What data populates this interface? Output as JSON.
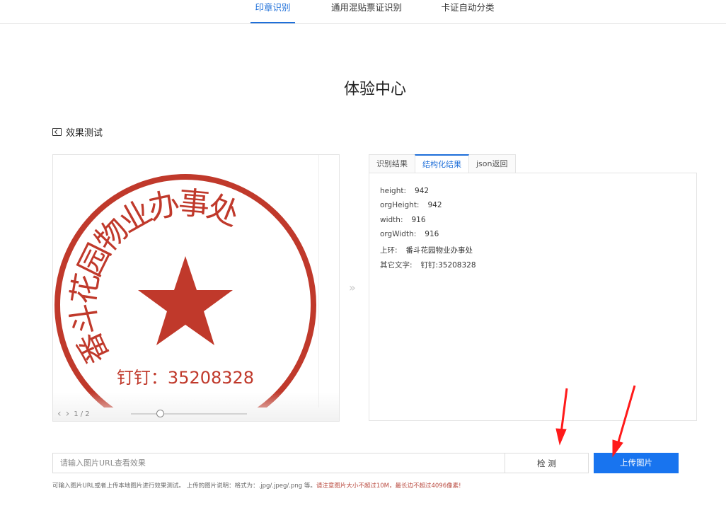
{
  "topnav": {
    "tabs": [
      "印章识别",
      "通用混贴票证识别",
      "卡证自动分类"
    ],
    "active_index": 0
  },
  "page_title": "体验中心",
  "section": {
    "label": "效果测试",
    "icon": "code-icon"
  },
  "preview": {
    "stamp": {
      "ring_text": [
        "番",
        "斗",
        "花",
        "园",
        "物",
        "业",
        "办",
        "事",
        "处"
      ],
      "bottom_text": "钉钉：35208328",
      "color": "#c0392b"
    },
    "pager": "1 / 2",
    "zoom_level": 0.25
  },
  "result": {
    "tabs": [
      "识别结果",
      "结构化结果",
      "json返回"
    ],
    "active_index": 1,
    "fields": [
      {
        "key": "height:",
        "value": "942"
      },
      {
        "key": "orgHeight:",
        "value": "942"
      },
      {
        "key": "width:",
        "value": "916"
      },
      {
        "key": "orgWidth:",
        "value": "916"
      },
      {
        "key": "上环:",
        "value": "番斗花园物业办事处"
      },
      {
        "key": "其它文字:",
        "value": "钉钉:35208328"
      }
    ]
  },
  "controls": {
    "url_placeholder": "请输入图片URL查看效果",
    "detect_label": "检 测",
    "upload_label": "上传图片"
  },
  "hint": {
    "text": "可输入图片URL或者上传本地图片进行效果测试。 上传的图片说明：格式为：.jpg/.jpeg/.png 等。",
    "warn": "请注意图片大小不超过10M，最长边不超过4096像素!"
  },
  "colors": {
    "accent": "#1e6fd9",
    "upload_button": "#1874ef",
    "annotation_arrow": "#ff1a1a"
  }
}
